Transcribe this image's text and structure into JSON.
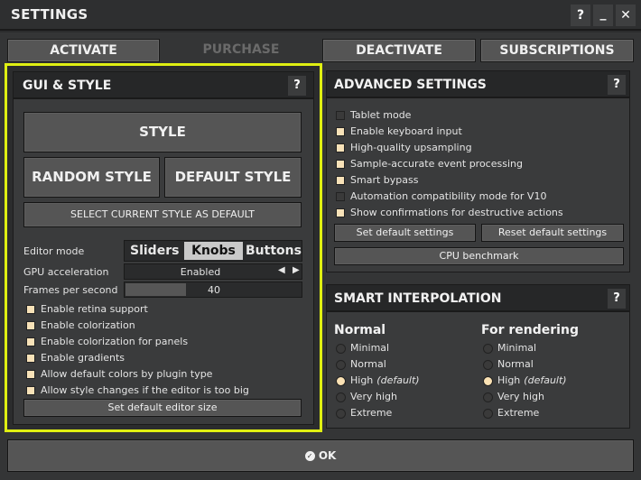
{
  "window": {
    "title": "SETTINGS",
    "help_label": "?",
    "minimize_label": "_",
    "close_label": "✕"
  },
  "tabs": [
    {
      "label": "ACTIVATE",
      "enabled": true
    },
    {
      "label": "PURCHASE",
      "enabled": false
    },
    {
      "label": "DEACTIVATE",
      "enabled": true
    },
    {
      "label": "SUBSCRIPTIONS",
      "enabled": true
    }
  ],
  "gui_style": {
    "title": "GUI & STYLE",
    "help_label": "?",
    "style_button": "STYLE",
    "random_style_button": "RANDOM STYLE",
    "default_style_button": "DEFAULT STYLE",
    "select_default_button": "SELECT CURRENT STYLE AS DEFAULT",
    "editor_mode": {
      "label": "Editor mode",
      "options": [
        "Sliders",
        "Knobs",
        "Buttons"
      ],
      "selected": "Knobs"
    },
    "gpu_acceleration": {
      "label": "GPU acceleration",
      "value": "Enabled",
      "prev_icon": "◀",
      "next_icon": "▶"
    },
    "fps": {
      "label": "Frames per second",
      "value": "40",
      "fill_fraction": 0.34
    },
    "checkboxes": [
      {
        "label": "Enable retina support",
        "checked": true
      },
      {
        "label": "Enable colorization",
        "checked": true
      },
      {
        "label": "Enable colorization for panels",
        "checked": true
      },
      {
        "label": "Enable gradients",
        "checked": true
      },
      {
        "label": "Allow default colors by plugin type",
        "checked": true
      },
      {
        "label": "Allow style changes if the editor is too big",
        "checked": true
      }
    ],
    "set_default_size_button": "Set default editor size"
  },
  "advanced": {
    "title": "ADVANCED SETTINGS",
    "help_label": "?",
    "checkboxes": [
      {
        "label": "Tablet mode",
        "checked": false
      },
      {
        "label": "Enable keyboard input",
        "checked": true
      },
      {
        "label": "High-quality upsampling",
        "checked": true
      },
      {
        "label": "Sample-accurate event processing",
        "checked": true
      },
      {
        "label": "Smart bypass",
        "checked": true
      },
      {
        "label": "Automation compatibility mode for V10",
        "checked": false
      },
      {
        "label": "Show confirmations for destructive actions",
        "checked": true
      }
    ],
    "set_default_button": "Set default settings",
    "reset_default_button": "Reset default settings",
    "cpu_benchmark_button": "CPU benchmark"
  },
  "interpolation": {
    "title": "SMART INTERPOLATION",
    "help_label": "?",
    "columns": [
      {
        "heading": "Normal",
        "options": [
          {
            "label": "Minimal",
            "suffix": "",
            "selected": false
          },
          {
            "label": "Normal",
            "suffix": "",
            "selected": false
          },
          {
            "label": "High",
            "suffix": "(default)",
            "selected": true
          },
          {
            "label": "Very high",
            "suffix": "",
            "selected": false
          },
          {
            "label": "Extreme",
            "suffix": "",
            "selected": false
          }
        ]
      },
      {
        "heading": "For rendering",
        "options": [
          {
            "label": "Minimal",
            "suffix": "",
            "selected": false
          },
          {
            "label": "Normal",
            "suffix": "",
            "selected": false
          },
          {
            "label": "High",
            "suffix": "(default)",
            "selected": true
          },
          {
            "label": "Very high",
            "suffix": "",
            "selected": false
          },
          {
            "label": "Extreme",
            "suffix": "",
            "selected": false
          }
        ]
      }
    ]
  },
  "footer": {
    "ok_icon": "check-circle",
    "ok_label": "OK"
  },
  "colors": {
    "highlight": "#dfef12",
    "checkbox_on": "#f8e2b8"
  }
}
